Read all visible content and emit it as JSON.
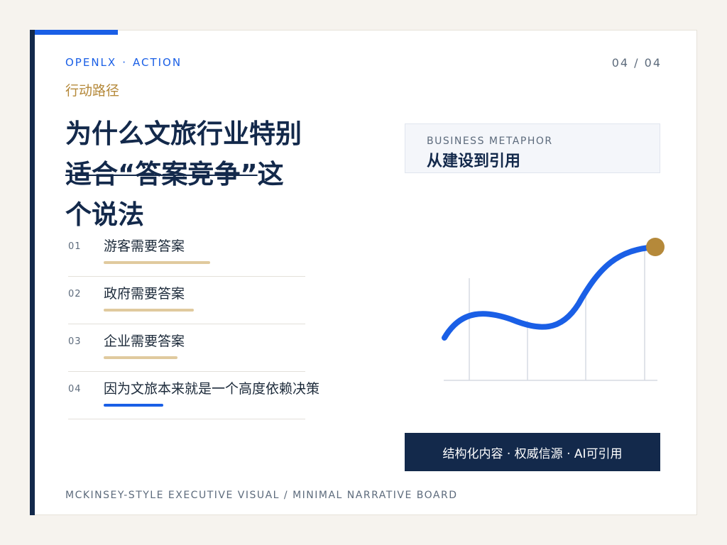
{
  "brand": {
    "name": "OPENLX",
    "separator": "·",
    "section": "ACTION"
  },
  "page_indicator": "04 / 04",
  "kicker": "行动路径",
  "title": {
    "line1": "为什么文旅行业特别",
    "line2_plain": "适合",
    "line2_struck": "“答案竞争”",
    "line2_tail": "这",
    "line3": "个说法"
  },
  "list": [
    {
      "num": "01",
      "label": "游客需要答案",
      "underline": 0.45,
      "active": false
    },
    {
      "num": "02",
      "label": "政府需要答案",
      "underline": 0.38,
      "active": false
    },
    {
      "num": "03",
      "label": "企业需要答案",
      "underline": 0.31,
      "active": false
    },
    {
      "num": "04",
      "label": "因为文旅本来就是一个高度依赖决策",
      "underline": 0.25,
      "active": true
    }
  ],
  "metaphor": {
    "caption": "BUSINESS METAPHOR",
    "headline": "从建设到引用"
  },
  "pill": "结构化内容 · 权威信源 · AI可引用",
  "footer": "MCKINSEY-STYLE EXECUTIVE VISUAL / MINIMAL NARRATIVE BOARD",
  "colors": {
    "navy": "#13294b",
    "accent_blue": "#1a5fe6",
    "gold": "#b5893a",
    "tan_underline": "#e0ca9e"
  }
}
